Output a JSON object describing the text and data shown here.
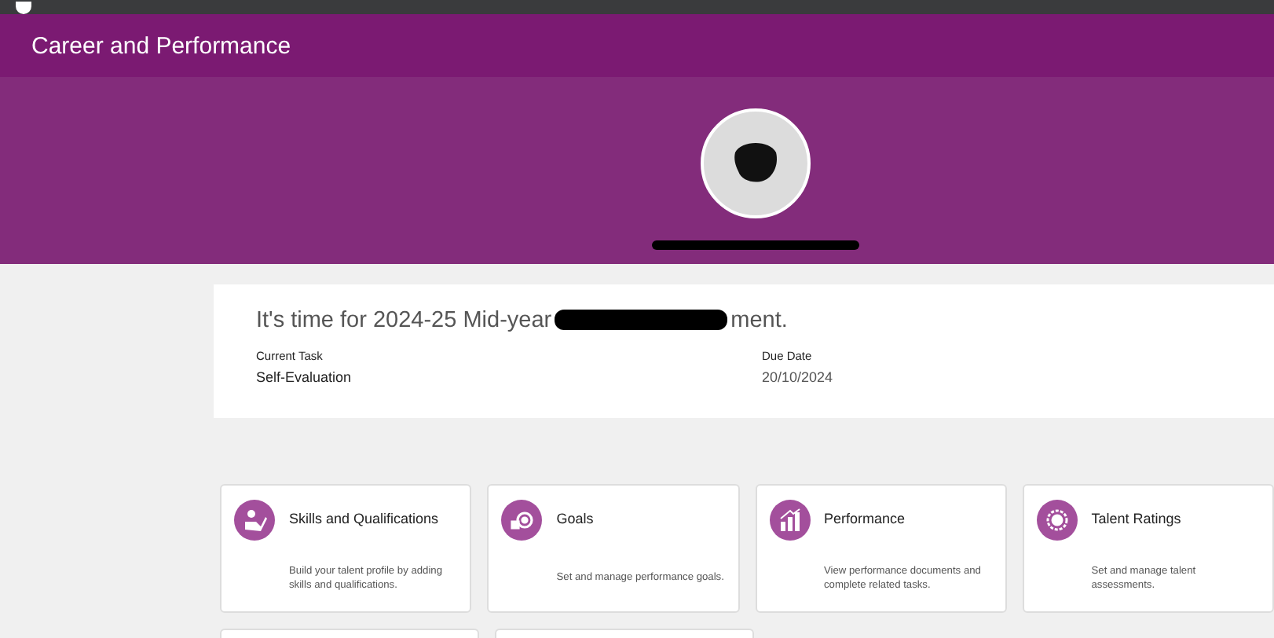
{
  "header": {
    "title": "Career and Performance"
  },
  "task_card": {
    "title_start": "It's time for 2024-25 Mid-year",
    "title_end": "ment.",
    "fields": [
      {
        "label": "Current Task",
        "value": "Self-Evaluation"
      },
      {
        "label": "Due Date",
        "value": "20/10/2024"
      }
    ]
  },
  "tiles": [
    {
      "kind": "skills",
      "title": "Skills and Qualifications",
      "description": "Build your talent profile by adding skills and qualifications."
    },
    {
      "kind": "goals",
      "title": "Goals",
      "description": "Set and manage performance goals."
    },
    {
      "kind": "performance",
      "title": "Performance",
      "description": "View performance documents and complete related tasks."
    },
    {
      "kind": "ratings",
      "title": "Talent Ratings",
      "description": "Set and manage talent assessments."
    }
  ]
}
